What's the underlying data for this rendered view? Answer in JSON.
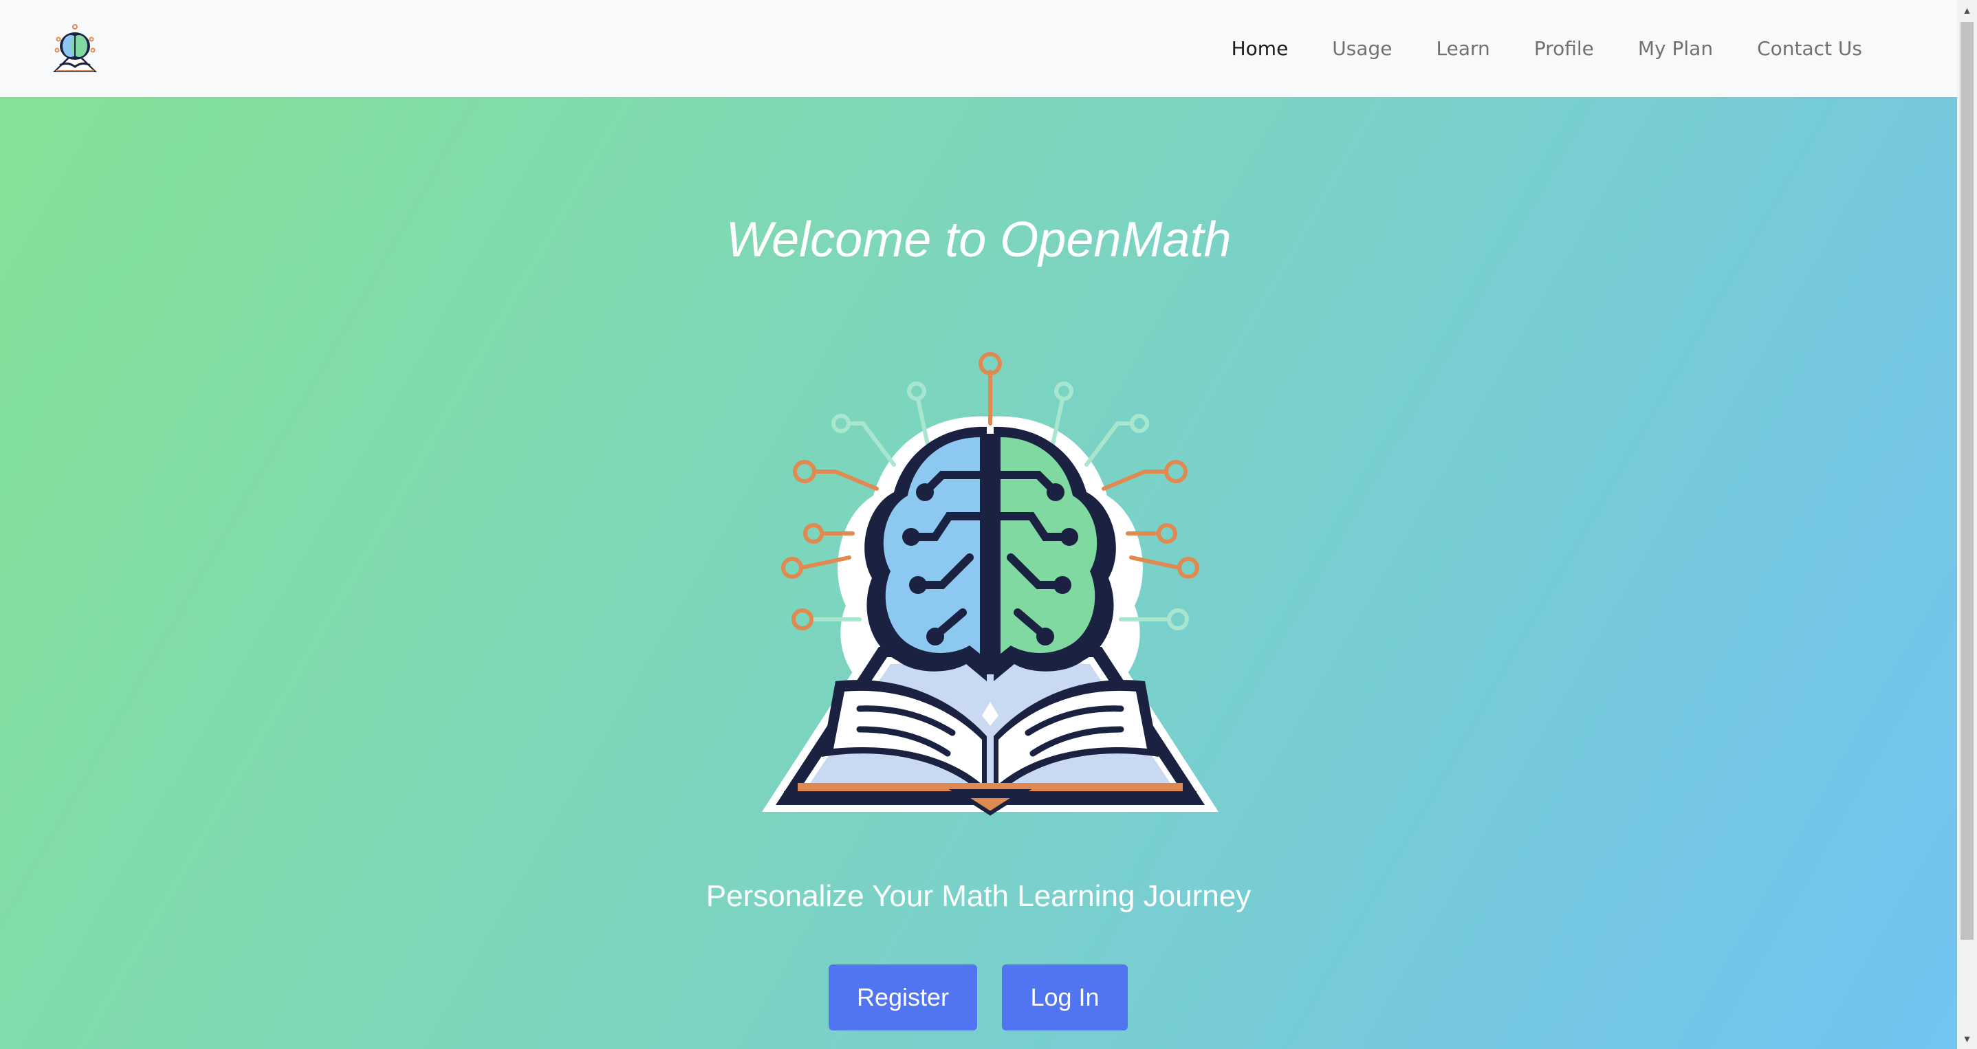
{
  "navbar": {
    "brand_icon": "openmath-brain-book-logo",
    "links": [
      {
        "label": "Home",
        "active": true
      },
      {
        "label": "Usage",
        "active": false
      },
      {
        "label": "Learn",
        "active": false
      },
      {
        "label": "Profile",
        "active": false
      },
      {
        "label": "My Plan",
        "active": false
      },
      {
        "label": "Contact Us",
        "active": false
      }
    ]
  },
  "hero": {
    "title": "Welcome to OpenMath",
    "logo_icon": "brain-on-open-book-logo",
    "subtitle": "Personalize Your Math Learning Journey",
    "register_label": "Register",
    "login_label": "Log In"
  },
  "colors": {
    "navbar_bg": "#f8f9fa",
    "gradient_start": "#84e296",
    "gradient_end": "#72c4f2",
    "button": "#5175f0",
    "brain_left": "#8cc8f0",
    "brain_right": "#7fd9a0",
    "circuit_orange": "#e08a52",
    "circuit_mint": "#a8e6d0",
    "outline": "#1b2140"
  },
  "scrollbar": {
    "up_icon": "triangle-up-icon",
    "down_icon": "triangle-down-icon"
  }
}
